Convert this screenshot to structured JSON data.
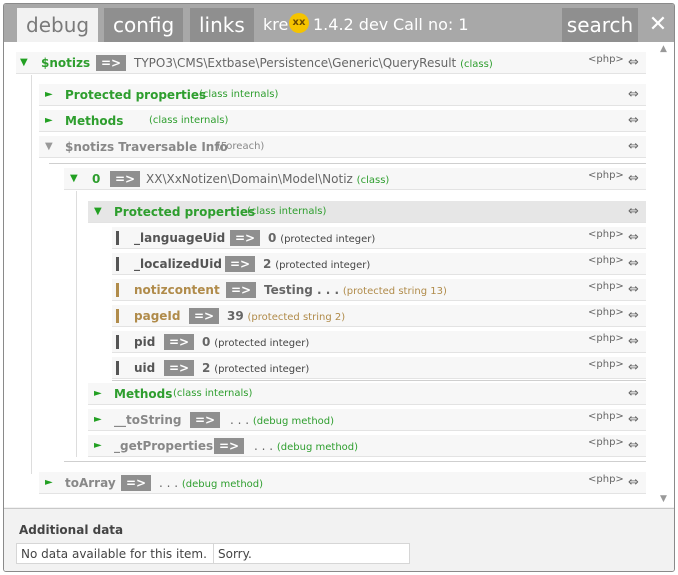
{
  "header": {
    "tabs": [
      "debug",
      "config",
      "links"
    ],
    "brand": "kre",
    "brand_icon": "xx",
    "version": "1.4.2 dev",
    "call_no": "Call no: 1",
    "search": "search",
    "close": "✕"
  },
  "rows": {
    "r1": {
      "name": "$notizs",
      "arrow": "=>",
      "value": "TYPO3\\CMS\\Extbase\\Persistence\\Generic\\QueryResult",
      "type": "(class)",
      "php": "<php>",
      "expand": "⇔"
    },
    "r2": {
      "name": "Protected properties",
      "type": "(class internals)",
      "expand": "⇔"
    },
    "r3": {
      "name": "Methods",
      "type": "(class internals)",
      "expand": "⇔"
    },
    "r4": {
      "name": "$notizs Traversable Info",
      "type": "(Foreach)",
      "expand": "⇔"
    },
    "r5": {
      "name": "0",
      "arrow": "=>",
      "value": "XX\\XxNotizen\\Domain\\Model\\Notiz",
      "type": "(class)",
      "php": "<php>",
      "expand": "⇔"
    },
    "r6": {
      "name": "Protected properties",
      "type": "(class internals)",
      "expand": "⇔"
    },
    "p1": {
      "name": "_languageUid",
      "arrow": "=>",
      "value": "0",
      "type": "(protected integer)",
      "php": "<php>",
      "expand": "⇔"
    },
    "p2": {
      "name": "_localizedUid",
      "arrow": "=>",
      "value": "2",
      "type": "(protected integer)",
      "php": "<php>",
      "expand": "⇔"
    },
    "p3": {
      "name": "notizcontent",
      "arrow": "=>",
      "value": "Testing . . .",
      "type": "(protected string 13)",
      "php": "<php>",
      "expand": "⇔"
    },
    "p4": {
      "name": "pageId",
      "arrow": "=>",
      "value": "39",
      "type": "(protected string 2)",
      "php": "<php>",
      "expand": "⇔"
    },
    "p5": {
      "name": "pid",
      "arrow": "=>",
      "value": "0",
      "type": "(protected integer)",
      "php": "<php>",
      "expand": "⇔"
    },
    "p6": {
      "name": "uid",
      "arrow": "=>",
      "value": "2",
      "type": "(protected integer)",
      "php": "<php>",
      "expand": "⇔"
    },
    "r7": {
      "name": "Methods",
      "type": "(class internals)",
      "expand": "⇔"
    },
    "r8": {
      "name": "__toString",
      "arrow": "=>",
      "value": ". . .",
      "type": "(debug method)",
      "php": "<php>",
      "expand": "⇔"
    },
    "r9": {
      "name": "_getProperties",
      "arrow": "=>",
      "value": ". . .",
      "type": "(debug method)",
      "php": "<php>",
      "expand": "⇔"
    },
    "r10": {
      "name": "toArray",
      "arrow": "=>",
      "value": ". . .",
      "type": "(debug method)",
      "php": "<php>",
      "expand": "⇔"
    }
  },
  "footer": {
    "title": "Additional data",
    "cell1": "No data available for this item.",
    "cell2": "Sorry."
  }
}
